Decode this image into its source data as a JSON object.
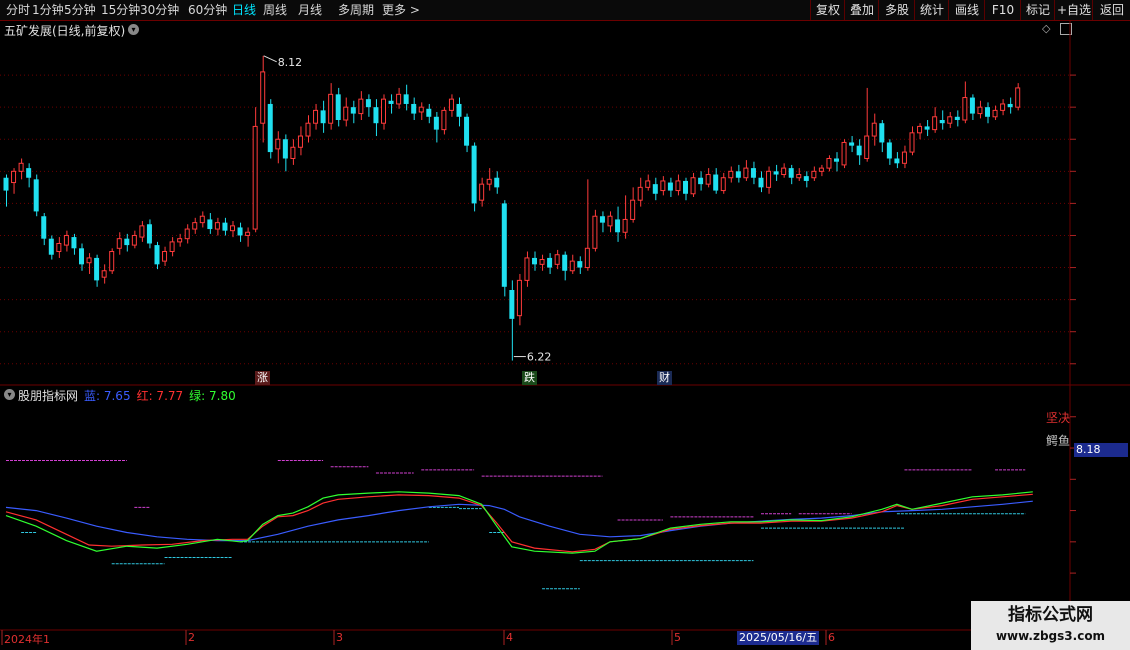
{
  "toolbar": {
    "periods": [
      {
        "label": "分时",
        "active": false
      },
      {
        "label": "1分钟",
        "active": false
      },
      {
        "label": "5分钟",
        "active": false
      },
      {
        "label": "15分钟",
        "active": false
      },
      {
        "label": "30分钟",
        "active": false
      },
      {
        "label": "60分钟",
        "active": false
      },
      {
        "label": "日线",
        "active": true
      },
      {
        "label": "周线",
        "active": false
      },
      {
        "label": "月线",
        "active": false
      },
      {
        "label": "多周期",
        "active": false
      },
      {
        "label": "更多 >",
        "active": false
      }
    ],
    "right_buttons": [
      "复权",
      "叠加",
      "多股",
      "统计",
      "画线",
      "F10",
      "标记",
      "+自选",
      "返回"
    ]
  },
  "main_chart": {
    "title": "五矿发展(日线,前复权)",
    "y_ticks": [
      "8.00",
      "7.80",
      "7.60",
      "7.40",
      "7.20",
      "7.00",
      "6.80",
      "6.60",
      "6.40",
      "6.20"
    ],
    "high_label": "8.12",
    "low_label": "6.22",
    "markers": {
      "up": "涨",
      "down": "跌",
      "finance": "财"
    },
    "colors": {
      "up": "#ff3b3b",
      "down": "#20e0f0",
      "grid": "#6b0000"
    }
  },
  "indicator": {
    "title": "股朋指标网",
    "legend": [
      {
        "label": "蓝: 7.65",
        "color": "#3a5cff"
      },
      {
        "label": "红: 7.77",
        "color": "#ff3030"
      },
      {
        "label": "绿: 7.80",
        "color": "#30ff30"
      }
    ],
    "y_ticks": [
      "9.00",
      "8.50",
      "8.00",
      "7.50",
      "7.00",
      "6.50",
      "6.00"
    ],
    "current_value": "8.18",
    "annotation_1": "坚决",
    "annotation_2": "鳄鱼"
  },
  "x_axis": {
    "labels": [
      "2024年1",
      "2",
      "3",
      "4",
      "5",
      "6"
    ],
    "cursor_date": "2025/05/16/五"
  },
  "watermark": {
    "title": "指标公式网",
    "url": "www.zbgs3.com"
  },
  "chart_data": {
    "type": "candlestick",
    "price_range": [
      6.13,
      8.25
    ],
    "indicator_range": [
      5.75,
      9.3
    ],
    "candles": [
      [
        7.36,
        7.28,
        7.38,
        7.18
      ],
      [
        7.33,
        7.4,
        7.42,
        7.26
      ],
      [
        7.4,
        7.45,
        7.48,
        7.35
      ],
      [
        7.42,
        7.36,
        7.45,
        7.3
      ],
      [
        7.35,
        7.15,
        7.38,
        7.12
      ],
      [
        7.12,
        6.98,
        7.14,
        6.94
      ],
      [
        6.98,
        6.88,
        7.0,
        6.85
      ],
      [
        6.9,
        6.95,
        6.99,
        6.86
      ],
      [
        6.94,
        7.0,
        7.03,
        6.9
      ],
      [
        6.99,
        6.92,
        7.01,
        6.88
      ],
      [
        6.92,
        6.82,
        6.95,
        6.78
      ],
      [
        6.83,
        6.86,
        6.89,
        6.76
      ],
      [
        6.86,
        6.72,
        6.88,
        6.68
      ],
      [
        6.74,
        6.78,
        6.82,
        6.7
      ],
      [
        6.78,
        6.9,
        6.92,
        6.76
      ],
      [
        6.92,
        6.98,
        7.02,
        6.88
      ],
      [
        6.98,
        6.94,
        7.01,
        6.9
      ],
      [
        6.94,
        7.0,
        7.03,
        6.92
      ],
      [
        6.99,
        7.06,
        7.09,
        6.96
      ],
      [
        7.07,
        6.95,
        7.1,
        6.92
      ],
      [
        6.94,
        6.82,
        6.96,
        6.79
      ],
      [
        6.84,
        6.9,
        6.93,
        6.81
      ],
      [
        6.9,
        6.96,
        6.99,
        6.87
      ],
      [
        6.96,
        6.98,
        7.01,
        6.93
      ],
      [
        6.98,
        7.04,
        7.07,
        6.95
      ],
      [
        7.04,
        7.08,
        7.11,
        7.01
      ],
      [
        7.08,
        7.12,
        7.15,
        7.05
      ],
      [
        7.1,
        7.04,
        7.14,
        7.01
      ],
      [
        7.04,
        7.08,
        7.11,
        7.0
      ],
      [
        7.08,
        7.03,
        7.11,
        7.0
      ],
      [
        7.03,
        7.06,
        7.09,
        6.99
      ],
      [
        7.05,
        7.0,
        7.08,
        6.96
      ],
      [
        7.0,
        7.02,
        7.05,
        6.93
      ],
      [
        7.04,
        7.68,
        7.8,
        7.02
      ],
      [
        7.7,
        8.02,
        8.12,
        7.58
      ],
      [
        7.82,
        7.52,
        7.85,
        7.48
      ],
      [
        7.54,
        7.6,
        7.65,
        7.45
      ],
      [
        7.6,
        7.48,
        7.63,
        7.4
      ],
      [
        7.48,
        7.55,
        7.6,
        7.44
      ],
      [
        7.55,
        7.62,
        7.68,
        7.5
      ],
      [
        7.62,
        7.7,
        7.75,
        7.58
      ],
      [
        7.7,
        7.78,
        7.82,
        7.66
      ],
      [
        7.78,
        7.7,
        7.84,
        7.64
      ],
      [
        7.7,
        7.88,
        7.95,
        7.66
      ],
      [
        7.88,
        7.72,
        7.92,
        7.68
      ],
      [
        7.72,
        7.8,
        7.86,
        7.68
      ],
      [
        7.8,
        7.76,
        7.84,
        7.7
      ],
      [
        7.76,
        7.85,
        7.9,
        7.72
      ],
      [
        7.85,
        7.8,
        7.88,
        7.74
      ],
      [
        7.8,
        7.7,
        7.85,
        7.62
      ],
      [
        7.7,
        7.85,
        7.88,
        7.66
      ],
      [
        7.84,
        7.82,
        7.88,
        7.76
      ],
      [
        7.82,
        7.88,
        7.92,
        7.79
      ],
      [
        7.88,
        7.82,
        7.94,
        7.78
      ],
      [
        7.82,
        7.76,
        7.86,
        7.72
      ],
      [
        7.77,
        7.8,
        7.83,
        7.72
      ],
      [
        7.79,
        7.74,
        7.82,
        7.7
      ],
      [
        7.74,
        7.66,
        7.77,
        7.58
      ],
      [
        7.66,
        7.78,
        7.8,
        7.63
      ],
      [
        7.78,
        7.85,
        7.88,
        7.74
      ],
      [
        7.82,
        7.74,
        7.86,
        7.68
      ],
      [
        7.74,
        7.56,
        7.76,
        7.52
      ],
      [
        7.56,
        7.2,
        7.58,
        7.15
      ],
      [
        7.22,
        7.32,
        7.36,
        7.18
      ],
      [
        7.32,
        7.35,
        7.42,
        7.28
      ],
      [
        7.36,
        7.3,
        7.4,
        7.26
      ],
      [
        7.2,
        6.68,
        7.22,
        6.62
      ],
      [
        6.66,
        6.48,
        6.72,
        6.22
      ],
      [
        6.5,
        6.72,
        6.76,
        6.44
      ],
      [
        6.72,
        6.86,
        6.9,
        6.68
      ],
      [
        6.86,
        6.82,
        6.9,
        6.78
      ],
      [
        6.82,
        6.85,
        6.88,
        6.78
      ],
      [
        6.86,
        6.8,
        6.89,
        6.76
      ],
      [
        6.82,
        6.88,
        6.91,
        6.79
      ],
      [
        6.88,
        6.78,
        6.9,
        6.72
      ],
      [
        6.78,
        6.84,
        6.88,
        6.76
      ],
      [
        6.84,
        6.8,
        6.87,
        6.76
      ],
      [
        6.8,
        6.92,
        7.35,
        6.78
      ],
      [
        6.92,
        7.12,
        7.16,
        6.9
      ],
      [
        7.12,
        7.08,
        7.15,
        7.02
      ],
      [
        7.06,
        7.12,
        7.15,
        7.02
      ],
      [
        7.1,
        7.02,
        7.18,
        6.96
      ],
      [
        7.02,
        7.1,
        7.25,
        6.98
      ],
      [
        7.1,
        7.22,
        7.3,
        7.08
      ],
      [
        7.22,
        7.3,
        7.36,
        7.18
      ],
      [
        7.3,
        7.34,
        7.38,
        7.28
      ],
      [
        7.32,
        7.26,
        7.36,
        7.22
      ],
      [
        7.28,
        7.34,
        7.37,
        7.25
      ],
      [
        7.33,
        7.28,
        7.36,
        7.24
      ],
      [
        7.28,
        7.34,
        7.38,
        7.25
      ],
      [
        7.34,
        7.26,
        7.36,
        7.22
      ],
      [
        7.26,
        7.36,
        7.39,
        7.24
      ],
      [
        7.36,
        7.32,
        7.4,
        7.28
      ],
      [
        7.32,
        7.38,
        7.42,
        7.3
      ],
      [
        7.38,
        7.28,
        7.42,
        7.26
      ],
      [
        7.28,
        7.36,
        7.39,
        7.26
      ],
      [
        7.36,
        7.4,
        7.43,
        7.33
      ],
      [
        7.4,
        7.36,
        7.44,
        7.33
      ],
      [
        7.36,
        7.42,
        7.47,
        7.34
      ],
      [
        7.42,
        7.36,
        7.46,
        7.32
      ],
      [
        7.36,
        7.3,
        7.4,
        7.27
      ],
      [
        7.3,
        7.4,
        7.43,
        7.26
      ],
      [
        7.4,
        7.38,
        7.44,
        7.34
      ],
      [
        7.38,
        7.42,
        7.45,
        7.36
      ],
      [
        7.42,
        7.36,
        7.44,
        7.32
      ],
      [
        7.36,
        7.38,
        7.42,
        7.34
      ],
      [
        7.37,
        7.34,
        7.4,
        7.3
      ],
      [
        7.36,
        7.4,
        7.43,
        7.34
      ],
      [
        7.4,
        7.42,
        7.44,
        7.37
      ],
      [
        7.42,
        7.48,
        7.5,
        7.4
      ],
      [
        7.48,
        7.46,
        7.52,
        7.4
      ],
      [
        7.44,
        7.58,
        7.6,
        7.42
      ],
      [
        7.58,
        7.56,
        7.62,
        7.52
      ],
      [
        7.56,
        7.5,
        7.6,
        7.44
      ],
      [
        7.48,
        7.62,
        7.92,
        7.46
      ],
      [
        7.62,
        7.7,
        7.76,
        7.56
      ],
      [
        7.7,
        7.58,
        7.72,
        7.52
      ],
      [
        7.58,
        7.48,
        7.6,
        7.44
      ],
      [
        7.48,
        7.45,
        7.52,
        7.42
      ],
      [
        7.45,
        7.52,
        7.56,
        7.42
      ],
      [
        7.52,
        7.64,
        7.68,
        7.5
      ],
      [
        7.64,
        7.68,
        7.7,
        7.6
      ],
      [
        7.68,
        7.66,
        7.72,
        7.62
      ],
      [
        7.66,
        7.74,
        7.8,
        7.64
      ],
      [
        7.72,
        7.7,
        7.78,
        7.66
      ],
      [
        7.7,
        7.74,
        7.77,
        7.67
      ],
      [
        7.74,
        7.72,
        7.78,
        7.68
      ],
      [
        7.72,
        7.86,
        7.96,
        7.7
      ],
      [
        7.86,
        7.76,
        7.88,
        7.72
      ],
      [
        7.76,
        7.8,
        7.84,
        7.73
      ],
      [
        7.8,
        7.74,
        7.83,
        7.7
      ],
      [
        7.74,
        7.78,
        7.81,
        7.72
      ],
      [
        7.78,
        7.82,
        7.85,
        7.75
      ],
      [
        7.82,
        7.8,
        7.86,
        7.76
      ],
      [
        7.8,
        7.92,
        7.95,
        7.78
      ]
    ],
    "indicator_lines": {
      "blue": [
        [
          0,
          7.55
        ],
        [
          4,
          7.5
        ],
        [
          8,
          7.38
        ],
        [
          12,
          7.25
        ],
        [
          16,
          7.15
        ],
        [
          20,
          7.08
        ],
        [
          24,
          7.04
        ],
        [
          28,
          7.02
        ],
        [
          32,
          7.02
        ],
        [
          36,
          7.12
        ],
        [
          40,
          7.25
        ],
        [
          44,
          7.35
        ],
        [
          48,
          7.42
        ],
        [
          52,
          7.5
        ],
        [
          56,
          7.56
        ],
        [
          60,
          7.6
        ],
        [
          64,
          7.58
        ],
        [
          66,
          7.52
        ],
        [
          68,
          7.4
        ],
        [
          72,
          7.25
        ],
        [
          76,
          7.12
        ],
        [
          80,
          7.08
        ],
        [
          84,
          7.1
        ],
        [
          88,
          7.18
        ],
        [
          92,
          7.25
        ],
        [
          96,
          7.3
        ],
        [
          100,
          7.33
        ],
        [
          104,
          7.36
        ],
        [
          108,
          7.38
        ],
        [
          112,
          7.42
        ],
        [
          116,
          7.48
        ],
        [
          120,
          7.5
        ],
        [
          124,
          7.52
        ],
        [
          128,
          7.56
        ],
        [
          132,
          7.6
        ],
        [
          136,
          7.65
        ]
      ],
      "red": [
        [
          0,
          7.48
        ],
        [
          4,
          7.35
        ],
        [
          8,
          7.12
        ],
        [
          11,
          6.95
        ],
        [
          14,
          6.93
        ],
        [
          18,
          6.95
        ],
        [
          22,
          6.96
        ],
        [
          26,
          7.02
        ],
        [
          30,
          7.04
        ],
        [
          32,
          7.04
        ],
        [
          34,
          7.25
        ],
        [
          36,
          7.4
        ],
        [
          38,
          7.42
        ],
        [
          40,
          7.5
        ],
        [
          42,
          7.62
        ],
        [
          44,
          7.68
        ],
        [
          48,
          7.72
        ],
        [
          52,
          7.75
        ],
        [
          56,
          7.74
        ],
        [
          60,
          7.7
        ],
        [
          63,
          7.58
        ],
        [
          65,
          7.3
        ],
        [
          67,
          7.0
        ],
        [
          70,
          6.9
        ],
        [
          75,
          6.84
        ],
        [
          78,
          6.88
        ],
        [
          80,
          7.0
        ],
        [
          84,
          7.05
        ],
        [
          88,
          7.2
        ],
        [
          92,
          7.26
        ],
        [
          96,
          7.3
        ],
        [
          100,
          7.3
        ],
        [
          104,
          7.33
        ],
        [
          108,
          7.33
        ],
        [
          112,
          7.38
        ],
        [
          116,
          7.48
        ],
        [
          118,
          7.58
        ],
        [
          120,
          7.52
        ],
        [
          124,
          7.58
        ],
        [
          128,
          7.68
        ],
        [
          132,
          7.72
        ],
        [
          136,
          7.76
        ]
      ],
      "green": [
        [
          0,
          7.42
        ],
        [
          4,
          7.25
        ],
        [
          8,
          7.02
        ],
        [
          12,
          6.85
        ],
        [
          16,
          6.93
        ],
        [
          20,
          6.9
        ],
        [
          24,
          6.96
        ],
        [
          28,
          7.04
        ],
        [
          31,
          7.0
        ],
        [
          32,
          7.02
        ],
        [
          34,
          7.28
        ],
        [
          36,
          7.42
        ],
        [
          38,
          7.46
        ],
        [
          40,
          7.56
        ],
        [
          42,
          7.7
        ],
        [
          44,
          7.75
        ],
        [
          48,
          7.78
        ],
        [
          52,
          7.8
        ],
        [
          56,
          7.78
        ],
        [
          60,
          7.74
        ],
        [
          63,
          7.6
        ],
        [
          65,
          7.25
        ],
        [
          67,
          6.92
        ],
        [
          70,
          6.85
        ],
        [
          75,
          6.82
        ],
        [
          78,
          6.85
        ],
        [
          80,
          7.0
        ],
        [
          84,
          7.05
        ],
        [
          88,
          7.22
        ],
        [
          92,
          7.28
        ],
        [
          96,
          7.32
        ],
        [
          100,
          7.32
        ],
        [
          104,
          7.35
        ],
        [
          108,
          7.34
        ],
        [
          112,
          7.4
        ],
        [
          116,
          7.52
        ],
        [
          118,
          7.6
        ],
        [
          120,
          7.52
        ],
        [
          124,
          7.62
        ],
        [
          128,
          7.72
        ],
        [
          132,
          7.75
        ],
        [
          136,
          7.8
        ]
      ]
    },
    "dash_segments": {
      "magenta": [
        [
          0,
          16,
          8.3
        ],
        [
          17,
          19,
          7.55
        ],
        [
          36,
          42,
          8.3
        ],
        [
          43,
          48,
          8.2
        ],
        [
          49,
          54,
          8.1
        ],
        [
          55,
          62,
          8.15
        ],
        [
          63,
          79,
          8.05
        ],
        [
          81,
          87,
          7.35
        ],
        [
          88,
          99,
          7.4
        ],
        [
          100,
          104,
          7.45
        ],
        [
          105,
          112,
          7.45
        ],
        [
          119,
          128,
          8.15
        ],
        [
          131,
          135,
          8.15
        ]
      ],
      "cyan": [
        [
          2,
          4,
          7.15
        ],
        [
          14,
          21,
          6.65
        ],
        [
          21,
          30,
          6.75
        ],
        [
          31,
          56,
          7.0
        ],
        [
          56,
          60,
          7.55
        ],
        [
          60,
          63,
          7.53
        ],
        [
          64,
          66,
          7.15
        ],
        [
          71,
          76,
          6.25
        ],
        [
          76,
          99,
          6.7
        ],
        [
          100,
          119,
          7.22
        ],
        [
          118,
          135,
          7.45
        ]
      ]
    }
  }
}
